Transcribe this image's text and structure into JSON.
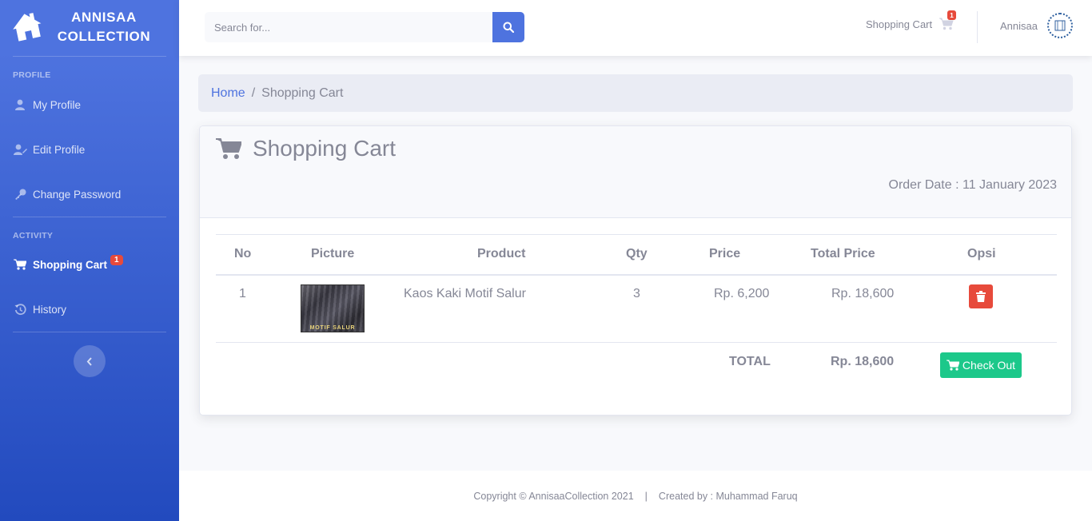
{
  "sidebar": {
    "brand_line1": "ANNISAA",
    "brand_line2": "COLLECTION",
    "heading_profile": "PROFILE",
    "heading_activity": "ACTIVITY",
    "items": [
      {
        "label": "My Profile",
        "icon": "user-icon"
      },
      {
        "label": "Edit Profile",
        "icon": "user-edit-icon"
      },
      {
        "label": "Change Password",
        "icon": "key-icon"
      },
      {
        "label": "Shopping Cart",
        "icon": "cart-icon",
        "badge": "1",
        "active": true
      },
      {
        "label": "History",
        "icon": "history-icon"
      }
    ]
  },
  "topbar": {
    "search_placeholder": "Search for...",
    "cart_label": "Shopping Cart",
    "cart_badge": "1",
    "user_name": "Annisaa"
  },
  "breadcrumb": {
    "home": "Home",
    "separator": "/",
    "current": "Shopping Cart"
  },
  "card": {
    "title": "Shopping Cart",
    "order_date": "Order Date : 11 January 2023",
    "columns": [
      "No",
      "Picture",
      "Product",
      "Qty",
      "Price",
      "Total Price",
      "Opsi"
    ],
    "rows": [
      {
        "no": "1",
        "picture_caption": "MOTIF SALUR",
        "product": "Kaos Kaki Motif Salur",
        "qty": "3",
        "price": "Rp. 6,200",
        "total_price": "Rp. 18,600"
      }
    ],
    "total_label": "TOTAL",
    "total_value": "Rp. 18,600",
    "checkout_label": "Check Out"
  },
  "footer": {
    "copyright": "Copyright © AnnisaaCollection 2021",
    "separator": "|",
    "created_by": "Created by : Muhammad Faruq"
  },
  "colors": {
    "primary": "#4e73df",
    "danger": "#e74a3b",
    "success": "#1cc88a",
    "text_muted": "#858796"
  }
}
